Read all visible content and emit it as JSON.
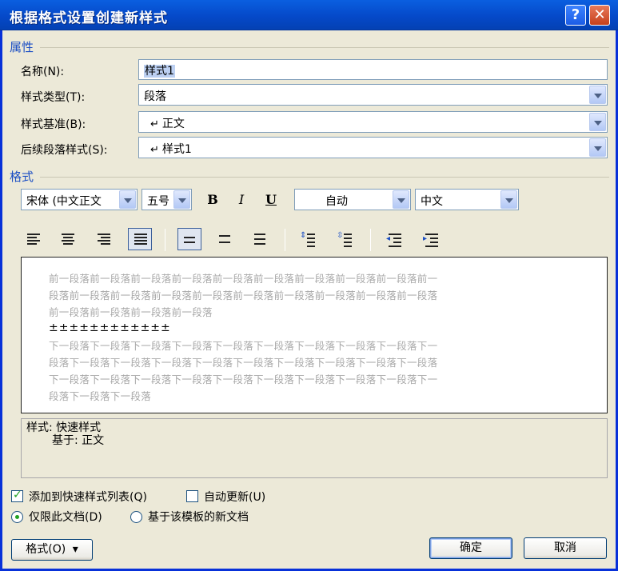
{
  "window": {
    "title": "根据格式设置创建新样式",
    "help_label": "?",
    "close_label": "✕"
  },
  "properties": {
    "section_label": "属性",
    "name_label": "名称(N):",
    "name_value": "样式1",
    "type_label": "样式类型(T):",
    "type_value": "段落",
    "based_on_label": "样式基准(B):",
    "based_on_value": "正文",
    "next_label": "后续段落样式(S):",
    "next_value": "样式1"
  },
  "format": {
    "section_label": "格式",
    "font": "宋体 (中文正文",
    "size": "五号",
    "bold": "B",
    "italic": "I",
    "underline": "U",
    "color": "自动",
    "script": "中文"
  },
  "preview": {
    "prev_lines": [
      "前一段落前一段落前一段落前一段落前一段落前一段落前一段落前一段落前一段落前一",
      "段落前一段落前一段落前一段落前一段落前一段落前一段落前一段落前一段落前一段落",
      "前一段落前一段落前一段落前一段落"
    ],
    "sample": "±±±±±±±±±±±±",
    "next_lines": [
      "下一段落下一段落下一段落下一段落下一段落下一段落下一段落下一段落下一段落下一",
      "段落下一段落下一段落下一段落下一段落下一段落下一段落下一段落下一段落下一段落",
      "下一段落下一段落下一段落下一段落下一段落下一段落下一段落下一段落下一段落下一",
      "段落下一段落下一段落"
    ]
  },
  "description": {
    "line1": "样式: 快速样式",
    "line2": "基于: 正文"
  },
  "options": {
    "add_quick_label": "添加到快速样式列表(Q)",
    "add_quick_checked": true,
    "auto_update_label": "自动更新(U)",
    "auto_update_checked": false,
    "this_doc_label": "仅限此文档(D)",
    "this_doc_selected": true,
    "template_label": "基于该模板的新文档",
    "template_selected": false
  },
  "buttons": {
    "format": "格式(O)",
    "format_arrow": "▾",
    "ok": "确定",
    "cancel": "取消"
  },
  "colors": {
    "title_bar": "#0a5fe0",
    "section_label": "#1c4fc4",
    "check_mark": "#21a121"
  }
}
